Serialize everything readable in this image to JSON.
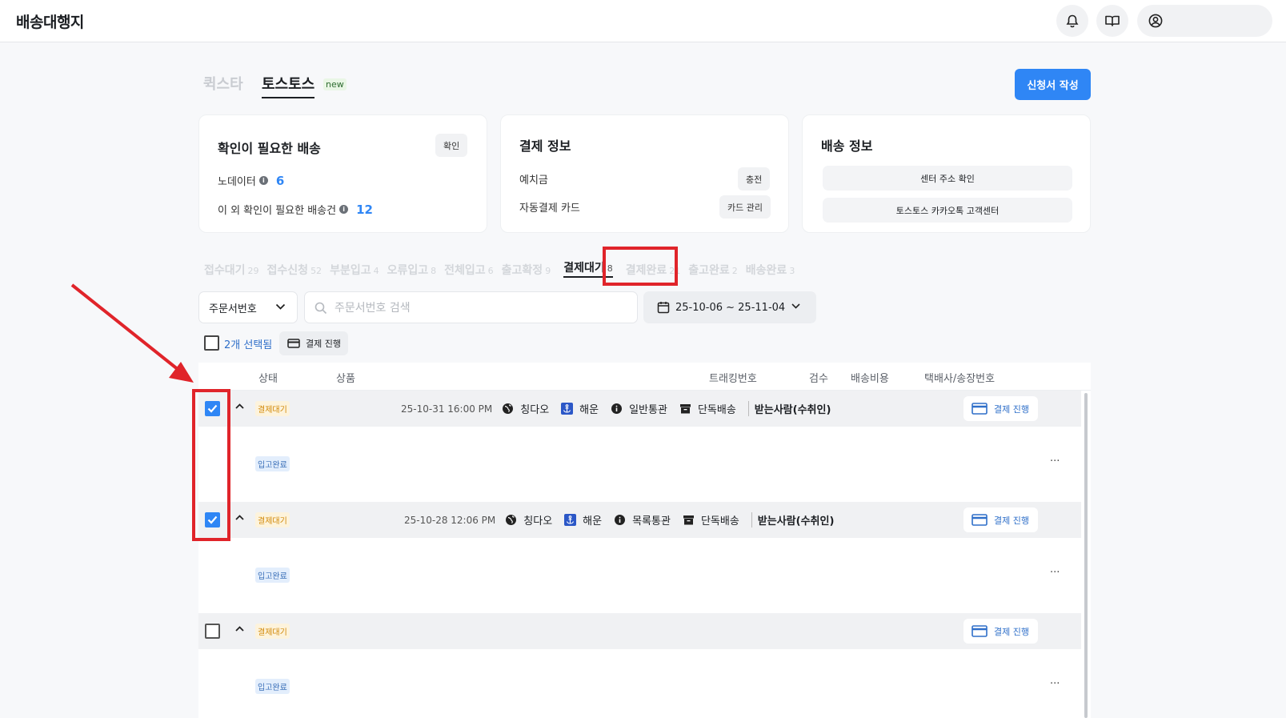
{
  "header": {
    "brand": "배송대행지"
  },
  "service_tabs": {
    "inactive": "퀵스타",
    "active": "토스토스",
    "new_badge": "new"
  },
  "apply_button": "신청서 작성",
  "cards": {
    "confirm": {
      "title": "확인이 필요한 배송",
      "button": "확인",
      "rows": [
        {
          "label": "노데이터",
          "count": "6"
        },
        {
          "label": "이 외 확인이 필요한 배송건",
          "count": "12"
        }
      ]
    },
    "payment": {
      "title": "결제 정보",
      "rows": [
        {
          "label": "예치금",
          "button": "충전"
        },
        {
          "label": "자동결제 카드",
          "button": "카드 관리"
        }
      ]
    },
    "shipping": {
      "title": "배송 정보",
      "buttons": [
        "센터 주소 확인",
        "토스토스 카카오톡 고객센터"
      ]
    }
  },
  "status_tabs": [
    {
      "label": "접수대기",
      "count": "29"
    },
    {
      "label": "접수신청",
      "count": "52"
    },
    {
      "label": "부분입고",
      "count": "4"
    },
    {
      "label": "오류입고",
      "count": "8"
    },
    {
      "label": "전체입고",
      "count": "6"
    },
    {
      "label": "출고확정",
      "count": "9"
    },
    {
      "label": "결제대기",
      "count": "8",
      "active": true
    },
    {
      "label": "결제완료",
      "count": "21"
    },
    {
      "label": "출고완료",
      "count": "2"
    },
    {
      "label": "배송완료",
      "count": "3"
    }
  ],
  "filters": {
    "search_type": "주문서번호",
    "search_placeholder": "주문서번호 검색",
    "date_range": "25-10-06 ~ 25-11-04"
  },
  "selection": {
    "selected_text": "2개 선택됨",
    "pay_button": "결제 진행"
  },
  "table": {
    "columns": [
      "상태",
      "상품",
      "트래킹번호",
      "검수",
      "배송비용",
      "택배사/송장번호"
    ],
    "orders": [
      {
        "checked": true,
        "status": "결제대기",
        "datetime": "25-10-31 16:00 PM",
        "origin": "칭다오",
        "method": "해운",
        "customs": "일반통관",
        "delivery": "단독배송",
        "recipient": "받는사람(수취인)",
        "pay_button": "결제 진행",
        "item_status": "입고완료",
        "more": "···"
      },
      {
        "checked": true,
        "status": "결제대기",
        "datetime": "25-10-28 12:06 PM",
        "origin": "칭다오",
        "method": "해운",
        "customs": "목록통관",
        "delivery": "단독배송",
        "recipient": "받는사람(수취인)",
        "pay_button": "결제 진행",
        "item_status": "입고완료",
        "more": "···"
      },
      {
        "checked": false,
        "status": "결제대기",
        "pay_button": "결제 진행",
        "item_status": "입고완료",
        "more": "···"
      }
    ]
  },
  "colors": {
    "accent": "#2f86f5",
    "highlight": "#e0242a",
    "pending_badge": "#d28a0a",
    "received_badge": "#3a6fb8"
  },
  "icons": [
    "bell-icon",
    "book-icon",
    "user-circle-icon",
    "chevron-down-icon",
    "search-icon",
    "calendar-icon",
    "card-icon",
    "globe-icon",
    "anchor-icon",
    "info-icon",
    "box-icon",
    "caret-up-icon"
  ]
}
